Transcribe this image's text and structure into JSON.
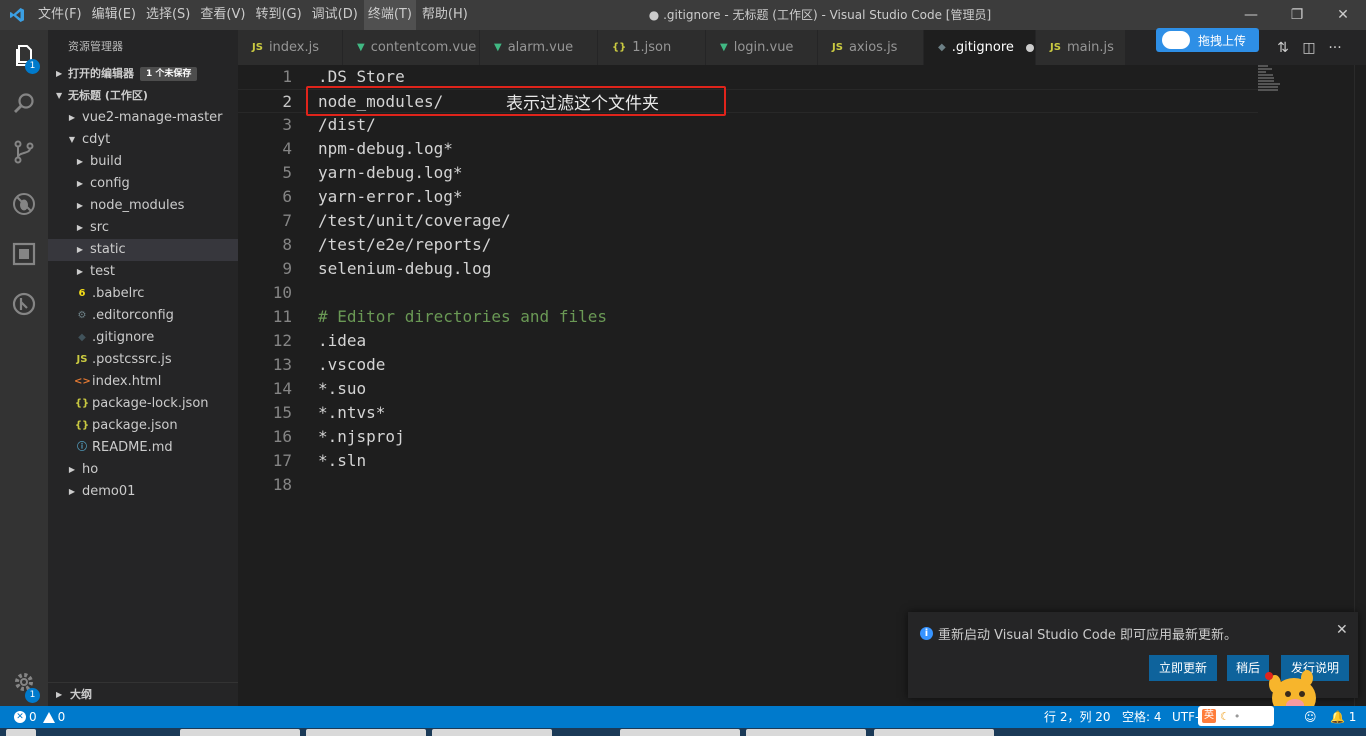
{
  "title_bar": {
    "menu": [
      "文件(F)",
      "编辑(E)",
      "选择(S)",
      "查看(V)",
      "转到(G)",
      "调试(D)",
      "终端(T)",
      "帮助(H)"
    ],
    "window_title": "● .gitignore - 无标题 (工作区) - Visual Studio Code [管理员]"
  },
  "activity_bar": {
    "explorer_badge": "1",
    "settings_badge": "1"
  },
  "sidebar": {
    "title": "资源管理器",
    "open_editors": "打开的编辑器",
    "unsaved": "1 个未保存",
    "workspace": "无标题 (工作区)",
    "outline": "大纲",
    "tree": [
      {
        "label": "vue2-manage-master",
        "depth": 1,
        "kind": "folder-closed"
      },
      {
        "label": "cdyt",
        "depth": 1,
        "kind": "folder-open"
      },
      {
        "label": "build",
        "depth": 2,
        "kind": "folder-closed"
      },
      {
        "label": "config",
        "depth": 2,
        "kind": "folder-closed"
      },
      {
        "label": "node_modules",
        "depth": 2,
        "kind": "folder-closed"
      },
      {
        "label": "src",
        "depth": 2,
        "kind": "folder-closed"
      },
      {
        "label": "static",
        "depth": 2,
        "kind": "folder-closed",
        "selected": true
      },
      {
        "label": "test",
        "depth": 2,
        "kind": "folder-closed"
      },
      {
        "label": ".babelrc",
        "depth": 2,
        "kind": "babel"
      },
      {
        "label": ".editorconfig",
        "depth": 2,
        "kind": "gear"
      },
      {
        "label": ".gitignore",
        "depth": 2,
        "kind": "git"
      },
      {
        "label": ".postcssrc.js",
        "depth": 2,
        "kind": "js"
      },
      {
        "label": "index.html",
        "depth": 2,
        "kind": "html"
      },
      {
        "label": "package-lock.json",
        "depth": 2,
        "kind": "json"
      },
      {
        "label": "package.json",
        "depth": 2,
        "kind": "json"
      },
      {
        "label": "README.md",
        "depth": 2,
        "kind": "info"
      },
      {
        "label": "ho",
        "depth": 1,
        "kind": "folder-closed"
      },
      {
        "label": "demo01",
        "depth": 1,
        "kind": "folder-closed"
      }
    ]
  },
  "tabs": [
    {
      "label": "index.js",
      "icon": "js",
      "active": false,
      "dirty": false
    },
    {
      "label": "contentcom.vue",
      "icon": "vue",
      "active": false,
      "dirty": false
    },
    {
      "label": "alarm.vue",
      "icon": "vue",
      "active": false,
      "dirty": false
    },
    {
      "label": "1.json",
      "icon": "json",
      "active": false,
      "dirty": false
    },
    {
      "label": "login.vue",
      "icon": "vue",
      "active": false,
      "dirty": false
    },
    {
      "label": "axios.js",
      "icon": "js",
      "active": false,
      "dirty": false
    },
    {
      "label": ".gitignore",
      "icon": "git",
      "active": true,
      "dirty": true
    },
    {
      "label": "main.js",
      "icon": "js",
      "active": false,
      "dirty": false
    }
  ],
  "upload_button": "拖拽上传",
  "editor": {
    "current_line": 2,
    "lines": [
      {
        "n": "1",
        "text": ".DS Store",
        "kind": "plain"
      },
      {
        "n": "2",
        "text": "node_modules/",
        "kind": "plain"
      },
      {
        "n": "3",
        "text": "/dist/",
        "kind": "plain"
      },
      {
        "n": "4",
        "text": "npm-debug.log*",
        "kind": "plain"
      },
      {
        "n": "5",
        "text": "yarn-debug.log*",
        "kind": "plain"
      },
      {
        "n": "6",
        "text": "yarn-error.log*",
        "kind": "plain"
      },
      {
        "n": "7",
        "text": "/test/unit/coverage/",
        "kind": "plain"
      },
      {
        "n": "8",
        "text": "/test/e2e/reports/",
        "kind": "plain"
      },
      {
        "n": "9",
        "text": "selenium-debug.log",
        "kind": "plain"
      },
      {
        "n": "10",
        "text": "",
        "kind": "plain"
      },
      {
        "n": "11",
        "text": "# Editor directories and files",
        "kind": "comment"
      },
      {
        "n": "12",
        "text": ".idea",
        "kind": "plain"
      },
      {
        "n": "13",
        "text": ".vscode",
        "kind": "plain"
      },
      {
        "n": "14",
        "text": "*.suo",
        "kind": "plain"
      },
      {
        "n": "15",
        "text": "*.ntvs*",
        "kind": "plain"
      },
      {
        "n": "16",
        "text": "*.njsproj",
        "kind": "plain"
      },
      {
        "n": "17",
        "text": "*.sln",
        "kind": "plain"
      },
      {
        "n": "18",
        "text": "",
        "kind": "plain"
      }
    ],
    "annotation": "表示过滤这个文件夹"
  },
  "notification": {
    "message": "重新启动 Visual Studio Code 即可应用最新更新。",
    "buttons": [
      "立即更新",
      "稍后",
      "发行说明"
    ]
  },
  "status_bar": {
    "errors": "0",
    "warnings": "0",
    "position": "行 2，列 20",
    "spaces": "空格: 4",
    "encoding": "UTF-",
    "bell_count": "1"
  },
  "ime": {
    "label": "英"
  },
  "colors": {
    "accent": "#007acc",
    "annotation_border": "#e0241b",
    "comment": "#6a9955"
  }
}
